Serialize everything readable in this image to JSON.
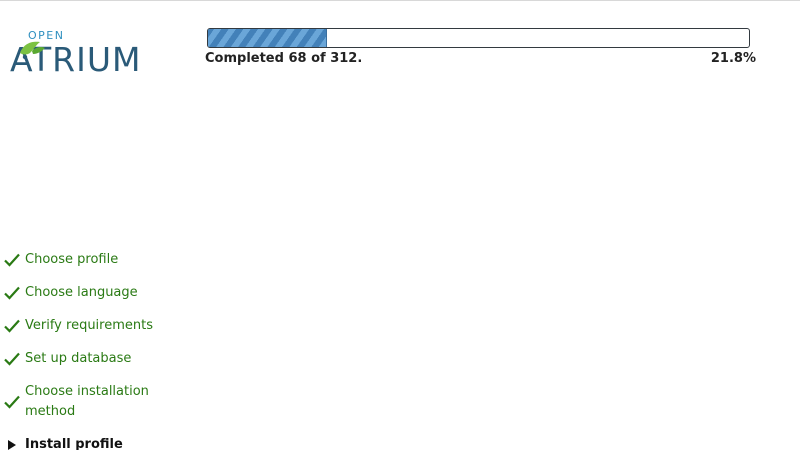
{
  "logo": {
    "small_text": "OPEN",
    "main_text": "ATRIUM",
    "leaf_color": "#7cc242"
  },
  "progress": {
    "message": "Completed 68 of 312.",
    "percent_label": "21.8%",
    "fraction": 0.218
  },
  "tasks": [
    {
      "label": "Choose profile",
      "status": "done"
    },
    {
      "label": "Choose language",
      "status": "done"
    },
    {
      "label": "Verify requirements",
      "status": "done"
    },
    {
      "label": "Set up database",
      "status": "done"
    },
    {
      "label": "Choose installation method",
      "status": "done"
    },
    {
      "label": "Install profile",
      "status": "active"
    }
  ],
  "colors": {
    "done": "#2a7a14",
    "active": "#111111",
    "bar_fill": "#4d8cc2"
  }
}
